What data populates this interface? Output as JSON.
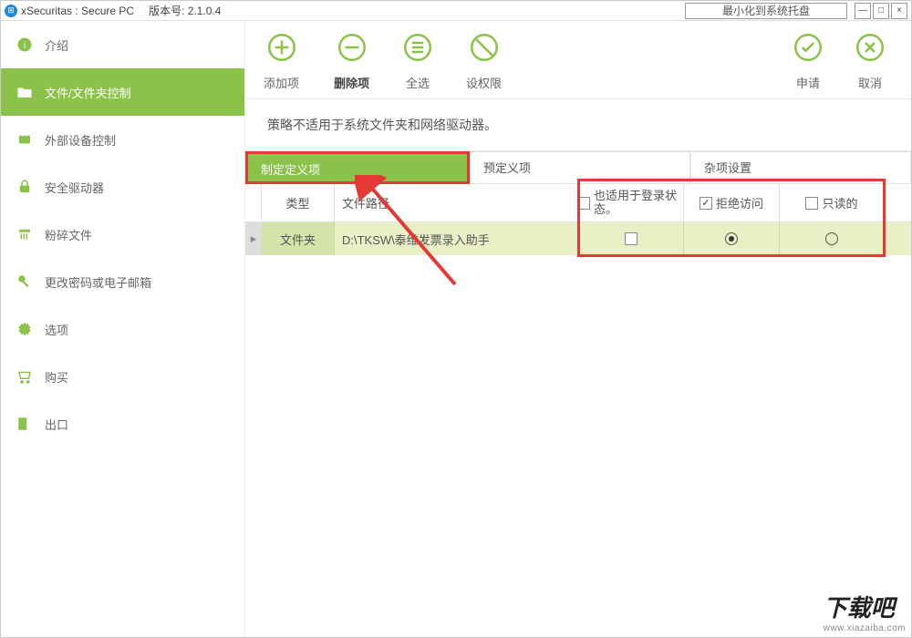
{
  "titlebar": {
    "title": "xSecuritas : Secure PC",
    "version_label": "版本号: 2.1.0.4",
    "tray_label": "最小化到系统托盘"
  },
  "sidebar": {
    "items": [
      {
        "label": "介绍"
      },
      {
        "label": "文件/文件夹控制"
      },
      {
        "label": "外部设备控制"
      },
      {
        "label": "安全驱动器"
      },
      {
        "label": "粉碎文件"
      },
      {
        "label": "更改密码或电子邮箱"
      },
      {
        "label": "选项"
      },
      {
        "label": "购买"
      },
      {
        "label": "出口"
      }
    ],
    "active_index": 1
  },
  "toolbar": {
    "add": "添加项",
    "delete": "删除项",
    "selectall": "全选",
    "permission": "设权限",
    "apply": "申请",
    "cancel": "取消"
  },
  "note": "策略不适用于系统文件夹和网络驱动器。",
  "tabs": {
    "custom": "制定定义项",
    "preset": "预定义项",
    "misc": "杂项设置",
    "active": "custom"
  },
  "table": {
    "headers": {
      "type": "类型",
      "path": "文件路径",
      "login": "也适用于登录状态。",
      "deny": "拒绝访问",
      "readonly": "只读的"
    },
    "header_checks": {
      "login": false,
      "deny": true,
      "readonly": false
    },
    "rows": [
      {
        "type": "文件夹",
        "path": "D:\\TKSW\\泰维发票录入助手",
        "login": false,
        "deny": true,
        "readonly": false
      }
    ]
  },
  "watermark": {
    "main": "下载吧",
    "sub": "www.xiazaiba.com"
  },
  "colors": {
    "accent": "#8bc34a",
    "highlight": "#e53935"
  }
}
